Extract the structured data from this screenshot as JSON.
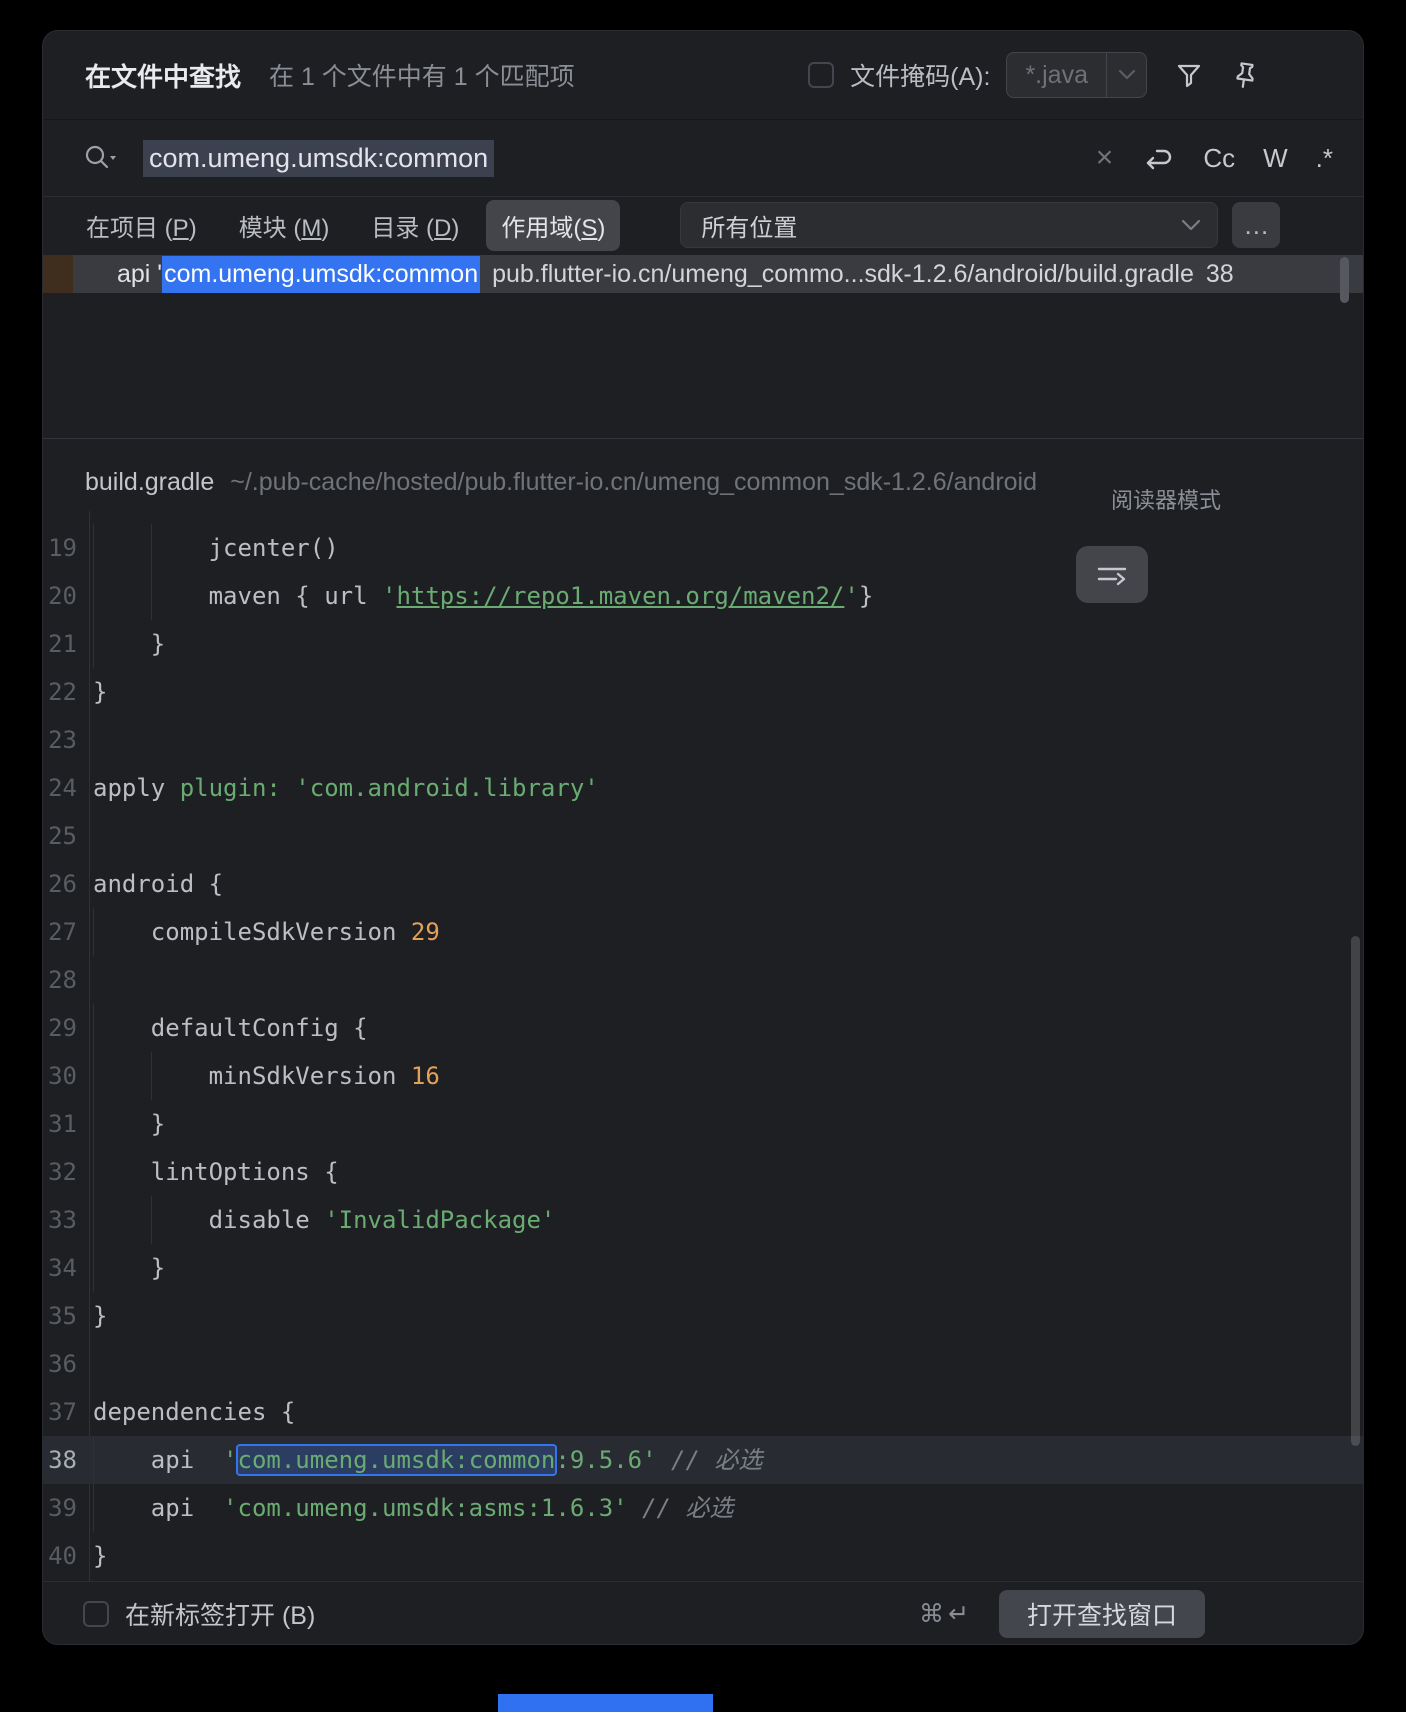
{
  "colors": {
    "accent_blue": "#3574f0",
    "string_green": "#6aab73",
    "number_orange": "#e2a158",
    "row_selected": "#393b40",
    "stripe_brown": "#3f2e1e",
    "dialog_bg": "#1e1f22"
  },
  "header": {
    "title": "在文件中查找",
    "summary": "在 1 个文件中有 1 个匹配项",
    "file_mask_label": "文件掩码(A):",
    "file_mask_value": "*.java"
  },
  "search": {
    "query": "com.umeng.umsdk:common",
    "clear_glyph": "×",
    "match_case": "Cc",
    "words": "W",
    "regex": ".*"
  },
  "scope": {
    "tabs": [
      {
        "pre": "在项目 (",
        "key": "P",
        "post": ")"
      },
      {
        "pre": "模块 (",
        "key": "M",
        "post": ")"
      },
      {
        "pre": "目录 (",
        "key": "D",
        "post": ")"
      },
      {
        "pre": "作用域(",
        "key": "S",
        "post": ")"
      }
    ],
    "selected_tab": "作用域(S)",
    "location": "所有位置",
    "more": "…"
  },
  "result": {
    "prefix": "api '",
    "match": "com.umeng.umsdk:common",
    "path": "pub.flutter-io.cn/umeng_commo...sdk-1.2.6/android/build.gradle",
    "line": "38"
  },
  "preview": {
    "file": "build.gradle",
    "path": "~/.pub-cache/hosted/pub.flutter-io.cn/umeng_common_sdk-1.2.6/android",
    "reader_mode": "阅读器模式"
  },
  "editor": {
    "current_line": "38",
    "lines": [
      {
        "n": "19",
        "tokens": [
          [
            "p",
            "        jcenter()"
          ]
        ]
      },
      {
        "n": "20",
        "tokens": [
          [
            "p",
            "        maven { url "
          ],
          [
            "s",
            "'"
          ],
          [
            "u",
            "https://repo1.maven.org/maven2/"
          ],
          [
            "s",
            "'"
          ],
          [
            "p",
            "}"
          ]
        ]
      },
      {
        "n": "21",
        "tokens": [
          [
            "p",
            "    }"
          ]
        ]
      },
      {
        "n": "22",
        "tokens": [
          [
            "p",
            "}"
          ]
        ]
      },
      {
        "n": "23",
        "tokens": []
      },
      {
        "n": "24",
        "tokens": [
          [
            "p",
            "apply "
          ],
          [
            "k",
            "plugin: "
          ],
          [
            "s",
            "'com.android.library'"
          ]
        ]
      },
      {
        "n": "25",
        "tokens": []
      },
      {
        "n": "26",
        "tokens": [
          [
            "p",
            "android {"
          ]
        ]
      },
      {
        "n": "27",
        "tokens": [
          [
            "p",
            "    compileSdkVersion "
          ],
          [
            "n",
            "29"
          ]
        ]
      },
      {
        "n": "28",
        "tokens": []
      },
      {
        "n": "29",
        "tokens": [
          [
            "p",
            "    defaultConfig {"
          ]
        ]
      },
      {
        "n": "30",
        "tokens": [
          [
            "p",
            "        minSdkVersion "
          ],
          [
            "n",
            "16"
          ]
        ]
      },
      {
        "n": "31",
        "tokens": [
          [
            "p",
            "    }"
          ]
        ]
      },
      {
        "n": "32",
        "tokens": [
          [
            "p",
            "    lintOptions {"
          ]
        ]
      },
      {
        "n": "33",
        "tokens": [
          [
            "p",
            "        disable "
          ],
          [
            "s",
            "'InvalidPackage'"
          ]
        ]
      },
      {
        "n": "34",
        "tokens": [
          [
            "p",
            "    }"
          ]
        ]
      },
      {
        "n": "35",
        "tokens": [
          [
            "p",
            "}"
          ]
        ]
      },
      {
        "n": "36",
        "tokens": []
      },
      {
        "n": "37",
        "tokens": [
          [
            "p",
            "dependencies {"
          ]
        ]
      },
      {
        "n": "38",
        "tokens": [
          [
            "p",
            "    api  "
          ],
          [
            "s",
            "'"
          ],
          [
            "m",
            "com.umeng.umsdk:common"
          ],
          [
            "s",
            ":9.5.6'"
          ],
          [
            "c",
            " // 必选"
          ]
        ]
      },
      {
        "n": "39",
        "tokens": [
          [
            "p",
            "    api  "
          ],
          [
            "s",
            "'com.umeng.umsdk:asms:1.6.3'"
          ],
          [
            "c",
            " // 必选"
          ]
        ]
      },
      {
        "n": "40",
        "tokens": [
          [
            "p",
            "}"
          ]
        ]
      }
    ]
  },
  "footer": {
    "open_in_new_tab": "在新标签打开 (B)",
    "shortcut": "⌘↵",
    "open_button": "打开查找窗口"
  }
}
